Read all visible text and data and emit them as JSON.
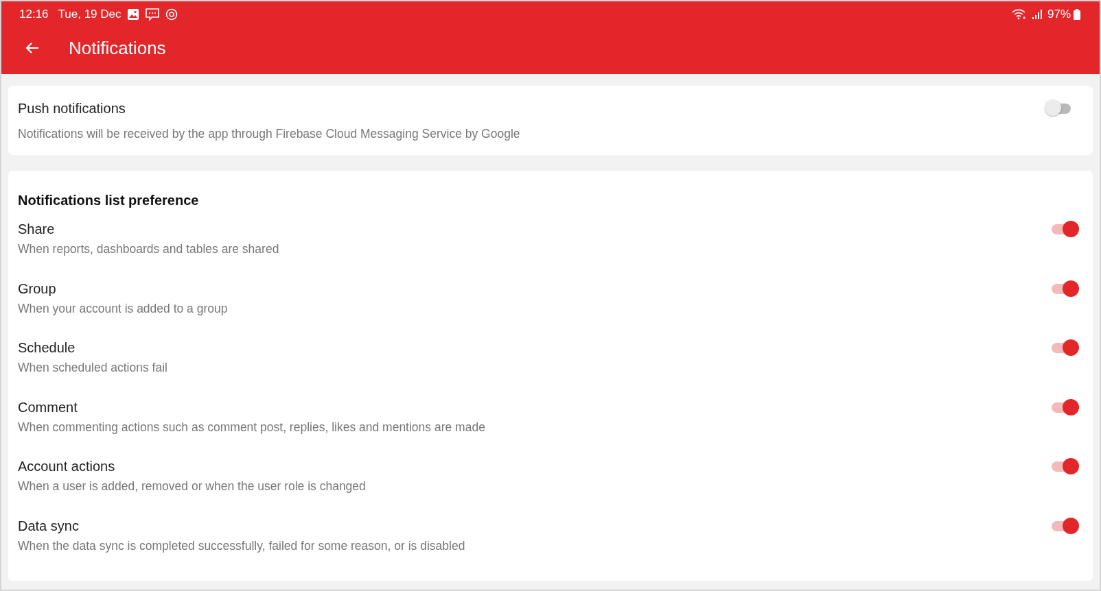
{
  "status_bar": {
    "time": "12:16",
    "date": "Tue, 19 Dec",
    "battery": "97%"
  },
  "app_bar": {
    "title": "Notifications"
  },
  "push": {
    "title": "Push notifications",
    "description": "Notifications will be received by the app through Firebase Cloud Messaging Service by Google",
    "on": false
  },
  "list_preference": {
    "heading": "Notifications list preference",
    "items": [
      {
        "title": "Share",
        "description": "When reports, dashboards and tables are shared",
        "on": true
      },
      {
        "title": "Group",
        "description": "When your account is added to a group",
        "on": true
      },
      {
        "title": "Schedule",
        "description": "When scheduled actions fail",
        "on": true
      },
      {
        "title": "Comment",
        "description": "When commenting actions such as comment post, replies, likes and mentions are made",
        "on": true
      },
      {
        "title": "Account actions",
        "description": "When a user is added, removed or when the user role is changed",
        "on": true
      },
      {
        "title": "Data sync",
        "description": "When the data sync is completed successfully, failed for some reason, or is disabled",
        "on": true
      }
    ]
  }
}
